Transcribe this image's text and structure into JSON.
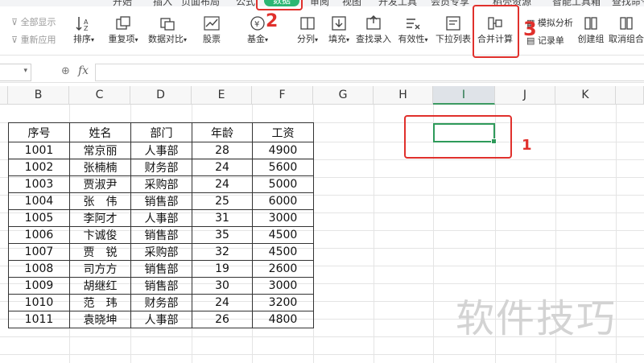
{
  "tabs": [
    {
      "label": "开始"
    },
    {
      "label": "插入"
    },
    {
      "label": "页面布局"
    },
    {
      "label": "公式"
    },
    {
      "label": "数据",
      "active": true
    },
    {
      "label": "审阅"
    },
    {
      "label": "视图"
    },
    {
      "label": "开发工具"
    },
    {
      "label": "会员专享"
    },
    {
      "label": "稻壳资源"
    },
    {
      "label": "智能工具箱"
    },
    {
      "label": "查找命令"
    }
  ],
  "ribbon": {
    "show_all": "全部显示",
    "reapply": "重新应用",
    "sort": "排序",
    "duplicates": "重复项",
    "compare": "数据对比",
    "stocks": "股票",
    "funds": "基金",
    "split": "分列",
    "fill": "填充",
    "lookup": "查找录入",
    "validity": "有效性",
    "dropdown": "下拉列表",
    "consolidate": "合并计算",
    "what_if": "模拟分析",
    "record": "记录单",
    "group": "创建组",
    "ungroup": "取消组合"
  },
  "formula_bar": {
    "fx": "fx",
    "value": ""
  },
  "columns": [
    "B",
    "C",
    "D",
    "E",
    "F",
    "G",
    "H",
    "I",
    "J",
    "K"
  ],
  "selected_column": "I",
  "table": {
    "headers": [
      "序号",
      "姓名",
      "部门",
      "年龄",
      "工资"
    ],
    "rows": [
      [
        "1001",
        "常京丽",
        "人事部",
        "28",
        "4900"
      ],
      [
        "1002",
        "张楠楠",
        "财务部",
        "24",
        "5600"
      ],
      [
        "1003",
        "贾淑尹",
        "采购部",
        "24",
        "5000"
      ],
      [
        "1004",
        "张　伟",
        "销售部",
        "25",
        "6000"
      ],
      [
        "1005",
        "李阿才",
        "人事部",
        "31",
        "3000"
      ],
      [
        "1006",
        "卞诚俊",
        "销售部",
        "35",
        "4500"
      ],
      [
        "1007",
        "贾　锐",
        "采购部",
        "32",
        "4500"
      ],
      [
        "1008",
        "司方方",
        "销售部",
        "19",
        "2600"
      ],
      [
        "1009",
        "胡继红",
        "销售部",
        "30",
        "3000"
      ],
      [
        "1010",
        "范　玮",
        "财务部",
        "24",
        "3200"
      ],
      [
        "1011",
        "袁晓坤",
        "人事部",
        "26",
        "4800"
      ]
    ]
  },
  "annotations": {
    "step1": "1",
    "step2": "2",
    "step3": "3"
  },
  "watermark": "软件技巧",
  "colors": {
    "accent": "#2bb673",
    "annotation": "#e0302c",
    "selection": "#2e9a5a"
  }
}
